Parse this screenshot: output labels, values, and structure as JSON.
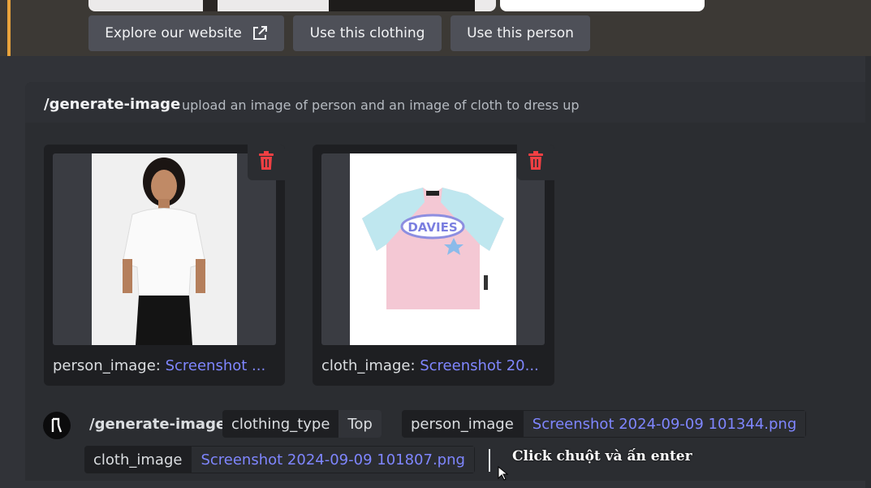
{
  "embed": {
    "buttons": {
      "explore": "Explore our website",
      "clothing": "Use this clothing",
      "person": "Use this person"
    },
    "accent_color": "#e8a33c"
  },
  "command": {
    "name": "/generate-image",
    "description": "upload an image of person and an image of cloth to dress up"
  },
  "attachments": [
    {
      "label": "person_image: ",
      "file": "Screenshot ..."
    },
    {
      "label": "cloth_image: ",
      "file": "Screenshot 20..."
    }
  ],
  "chat": {
    "command": "/generate-image",
    "options": [
      {
        "key": "clothing_type",
        "value": "Top"
      },
      {
        "key": "person_image",
        "value": "Screenshot 2024-09-09 101344.png"
      },
      {
        "key": "cloth_image",
        "value": "Screenshot 2024-09-09 101807.png"
      }
    ],
    "hint": "Click chuột và ấn enter"
  },
  "icons": {
    "external_link": "external-link-icon",
    "trash": "trash-icon",
    "bot_avatar": "bot-avatar-icon",
    "cursor": "mouse-cursor-icon"
  },
  "colors": {
    "link": "#7f86ff",
    "danger": "#f23f43"
  }
}
